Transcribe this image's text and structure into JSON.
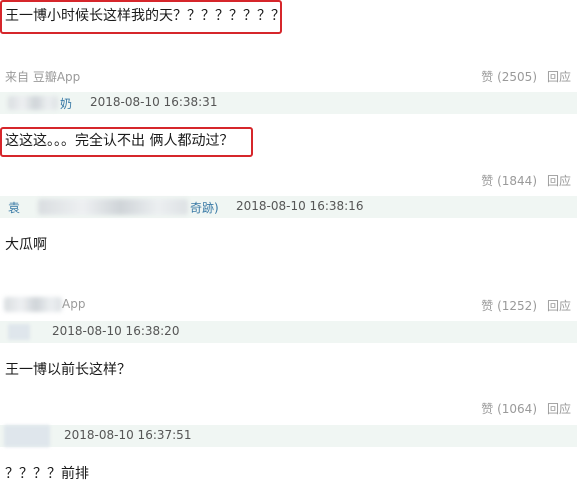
{
  "threads": [
    {
      "comment": "王一博小时候长这样我的天？？？？？？？？",
      "source": "来自 豆瓣App",
      "vote_label": "赞 (2505)",
      "reply_label": "回应",
      "author": "奶",
      "timestamp": "2018-08-10 16:38:31"
    },
    {
      "comment": "这这这。。。完全认不出 俩人都动过？",
      "vote_label": "赞 (1844)",
      "reply_label": "回应",
      "author_prefix": "袁",
      "author_suffix": "奇跡)",
      "timestamp": "2018-08-10 16:38:16"
    },
    {
      "comment": "大瓜啊",
      "source": "App",
      "vote_label": "赞 (1252)",
      "reply_label": "回应",
      "timestamp": "2018-08-10 16:38:20"
    },
    {
      "comment": "王一博以前长这样？",
      "vote_label": "赞 (1064)",
      "reply_label": "回应",
      "timestamp": "2018-08-10 16:37:51"
    },
    {
      "comment": "？？？？前排"
    }
  ],
  "colors": {
    "highlight_border": "#d6262b",
    "author_row_bg": "#f0f6f3",
    "link": "#3a7aa6",
    "muted": "#9a9a9a"
  }
}
